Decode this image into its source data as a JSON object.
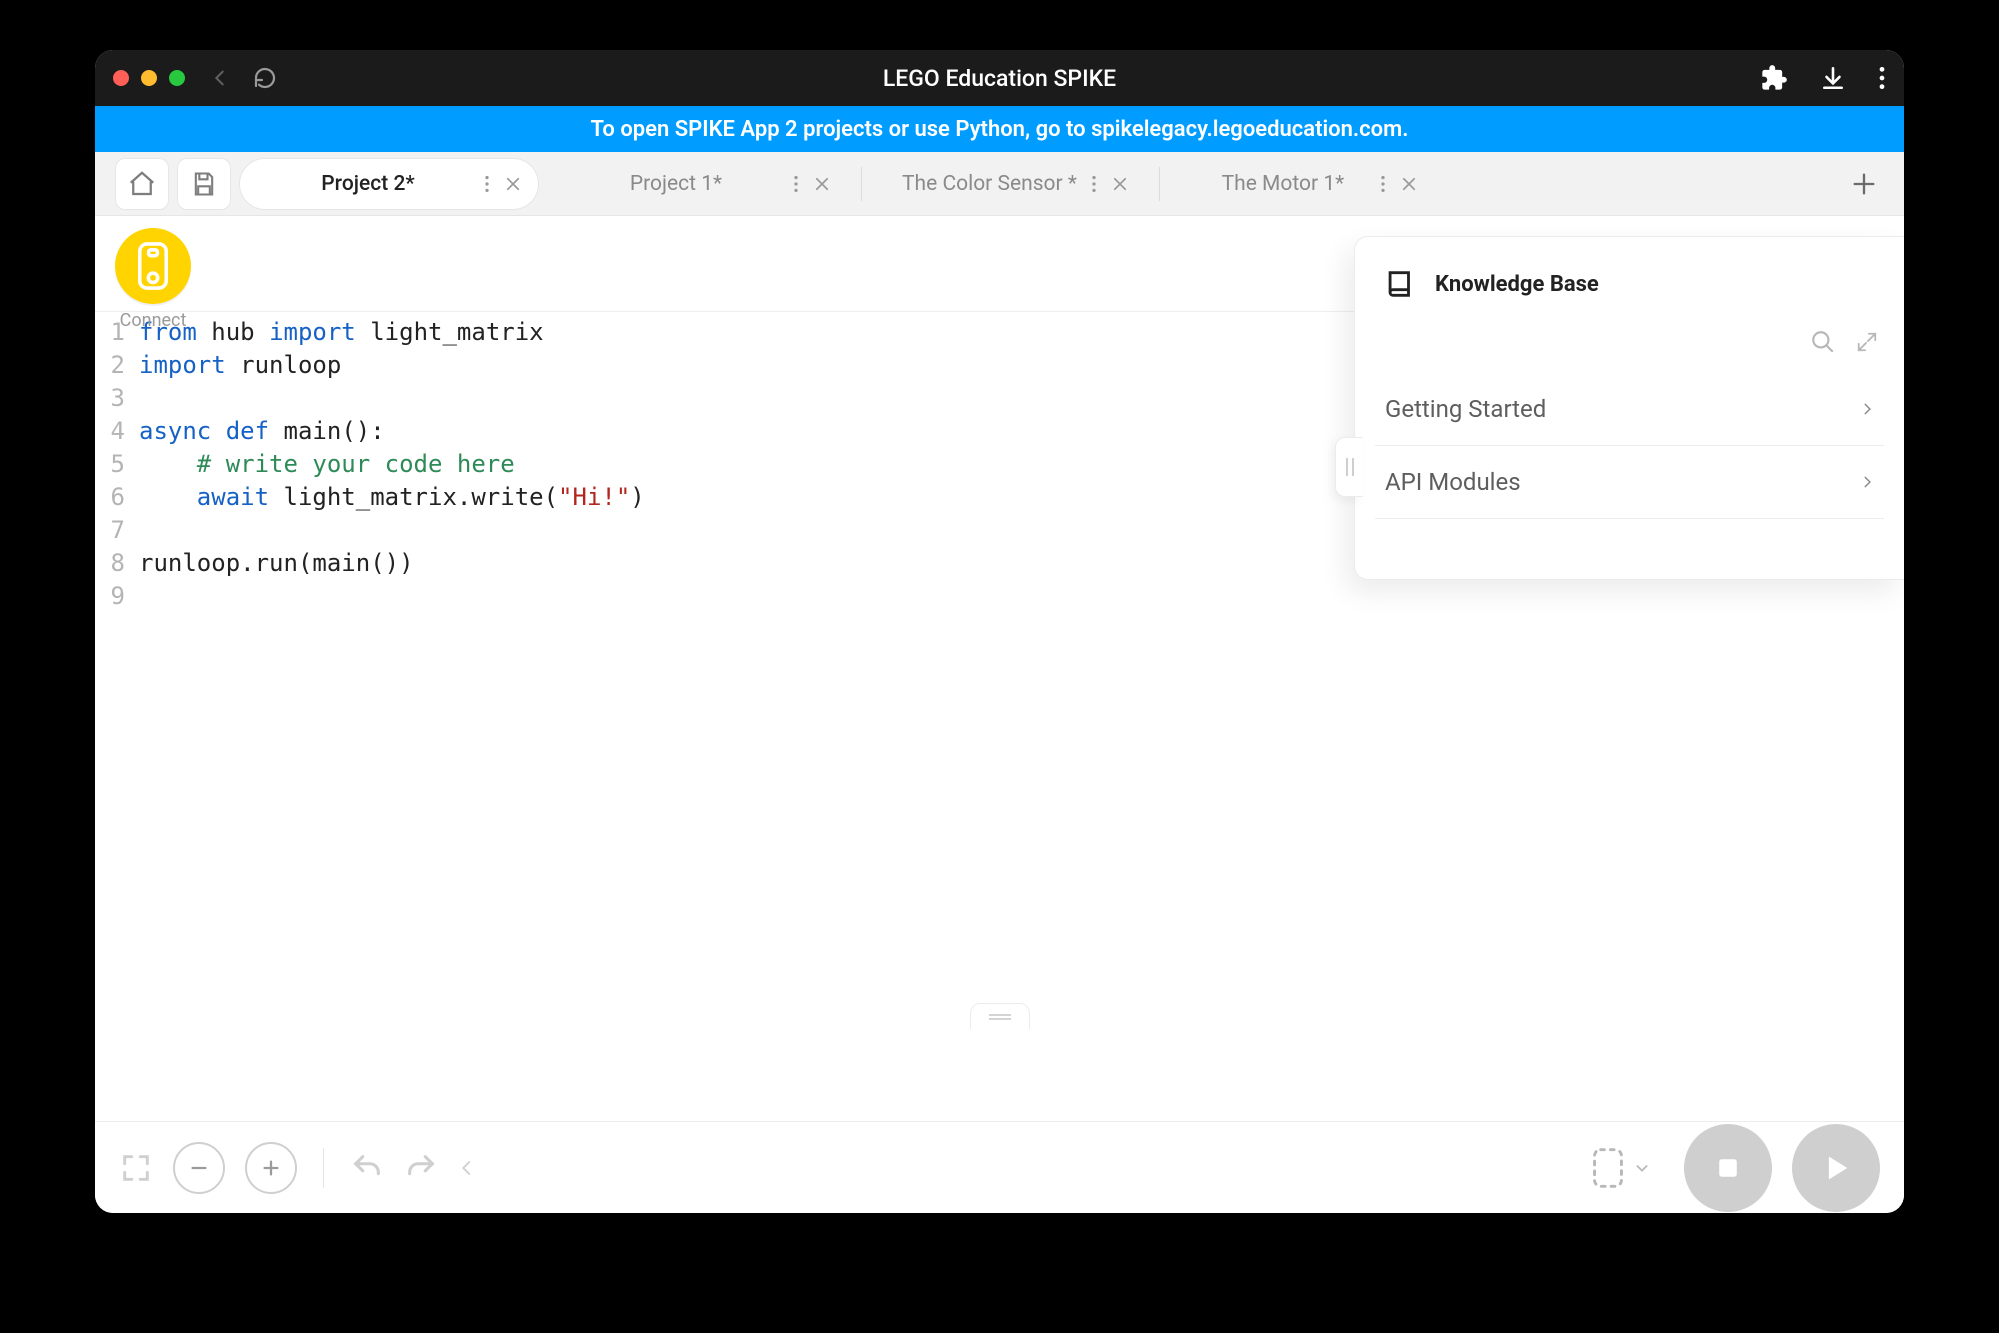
{
  "titlebar": {
    "title": "LEGO Education SPIKE"
  },
  "banner": {
    "text": "To open SPIKE App 2 projects or use Python, go to spikelegacy.legoeducation.com."
  },
  "tabs": {
    "items": [
      {
        "label": "Project 2*",
        "active": true
      },
      {
        "label": "Project 1*",
        "active": false
      },
      {
        "label": "The Color Sensor *",
        "active": false
      },
      {
        "label": "The Motor 1*",
        "active": false
      }
    ]
  },
  "connect": {
    "label": "Connect"
  },
  "code": {
    "lines": [
      "1",
      "2",
      "3",
      "4",
      "5",
      "6",
      "7",
      "8",
      "9"
    ],
    "l1_kw1": "from",
    "l1_mod": "hub",
    "l1_kw2": "import",
    "l1_name": "light_matrix",
    "l2_kw": "import",
    "l2_name": "runloop",
    "l4_kw1": "async",
    "l4_kw2": "def",
    "l4_name": "main",
    "l4_paren": "():",
    "l5_cm": "# write your code here",
    "l6_kw": "await",
    "l6_call1": "light_matrix.write(",
    "l6_str": "\"Hi!\"",
    "l6_call2": ")",
    "l8_a": "runloop.run(",
    "l8_b": "main",
    "l8_c": "()",
    "l8_d": ")"
  },
  "kb": {
    "title": "Knowledge Base",
    "items": [
      {
        "label": "Getting Started"
      },
      {
        "label": "API Modules"
      }
    ]
  }
}
